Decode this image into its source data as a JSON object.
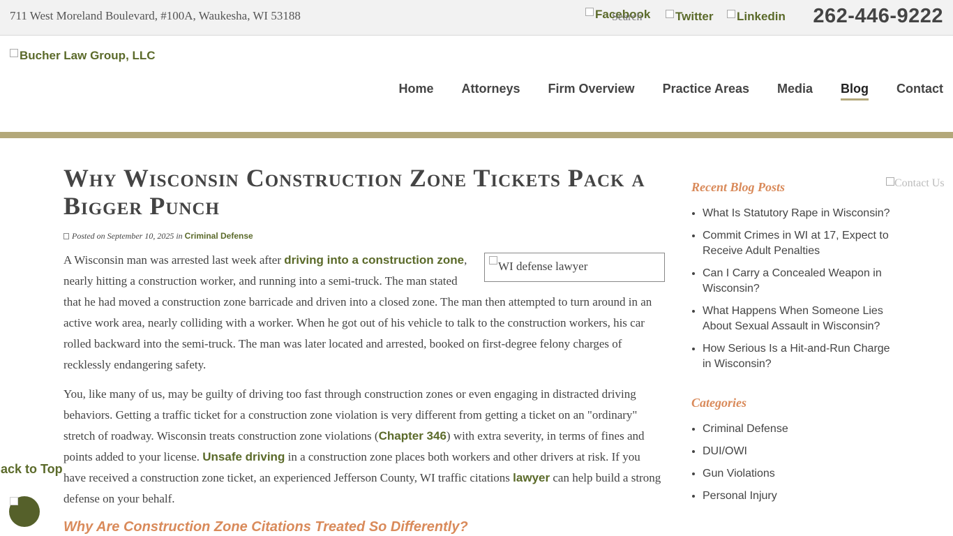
{
  "topbar": {
    "address": "711 West Moreland Boulevard, #100A, Waukesha, WI 53188",
    "social": {
      "facebook": "Facebook",
      "search": "Search",
      "twitter": "Twitter",
      "linkedin": "Linkedin"
    },
    "phone": "262-446-9222"
  },
  "header": {
    "logo_alt": "Bucher Law Group, LLC",
    "nav": [
      "Home",
      "Attorneys",
      "Firm Overview",
      "Practice Areas",
      "Media",
      "Blog",
      "Contact"
    ],
    "active_nav": "Blog",
    "accent_color": "#b3a87a"
  },
  "article": {
    "title": "Why Wisconsin Construction Zone Tickets Pack a Bigger Punch",
    "meta": {
      "posted_prefix": "Posted on",
      "date": "September 10, 2025",
      "in": "in",
      "category": "Criminal Defense"
    },
    "image_alt": "WI defense lawyer",
    "p1": {
      "before": "A Wisconsin man was arrested last week after ",
      "link": "driving into a construction zone",
      "after": ", nearly hitting a construction worker, and running into a semi-truck. The man stated that he had moved a construction zone barricade and driven into a closed zone. The man then attempted to turn around in an active work area, nearly colliding with a worker. When he got out of his vehicle to talk to the construction workers, his car rolled backward into the semi-truck. The man was later located and arrested, booked on first-degree felony charges of recklessly endangering safety."
    },
    "p2": {
      "t1": "You, like many of us, may be guilty of driving too fast through construction zones or even engaging in distracted driving behaviors. Getting a traffic ticket for a construction zone violation is very different from getting a ticket on an \"ordinary\" stretch of roadway. Wisconsin treats construction zone violations (",
      "link1": "Chapter 346",
      "t2": ") with extra severity, in terms of fines and points added to your license. ",
      "link2": "Unsafe driving",
      "t3": " in a construction zone places both workers and other drivers at risk. If you have received a construction zone ticket, an experienced Jefferson County, WI traffic citations ",
      "link3": "lawyer",
      "t4": " can help build a strong defense on your behalf."
    },
    "subhead": "Why Are Construction Zone Citations Treated So Differently?"
  },
  "sidebar": {
    "recent_title": "Recent Blog Posts",
    "recent": [
      "What Is Statutory Rape in Wisconsin?",
      "Commit Crimes in WI at 17, Expect to Receive Adult Penalties",
      "Can I Carry a Concealed Weapon in Wisconsin?",
      "What Happens When Someone Lies About Sexual Assault in Wisconsin?",
      "How Serious Is a Hit-and-Run Charge in Wisconsin?"
    ],
    "categories_title": "Categories",
    "categories": [
      "Criminal Defense",
      "DUI/OWI",
      "Gun Violations",
      "Personal Injury"
    ],
    "contact_alt": "Contact Us"
  },
  "back_to_top": "Back to Top"
}
